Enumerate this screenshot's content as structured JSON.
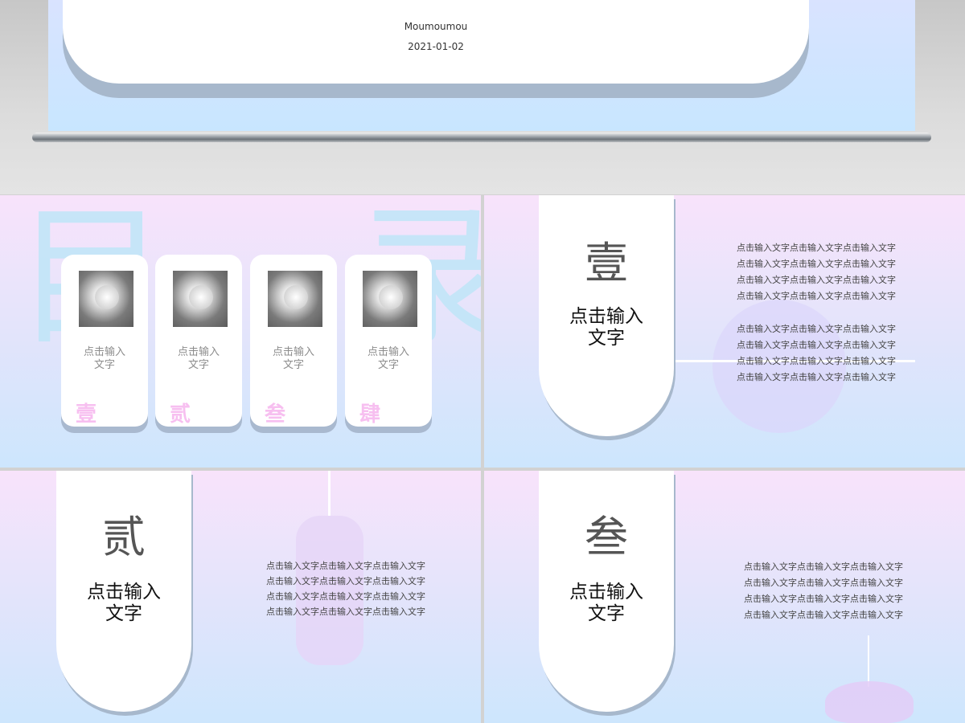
{
  "cover": {
    "author": "Moumoumou",
    "date": "2021-01-02"
  },
  "toc": {
    "background_chars": [
      "目",
      "录"
    ],
    "items": [
      {
        "label": "点击输入\n文字",
        "num": "壹"
      },
      {
        "label": "点击输入\n文字",
        "num": "贰"
      },
      {
        "label": "点击输入\n文字",
        "num": "叁"
      },
      {
        "label": "点击输入\n文字",
        "num": "肆"
      }
    ]
  },
  "section1": {
    "number": "壹",
    "title": "点击输入\n文字",
    "block1": [
      "点击输入文字点击输入文字点击输入文字",
      "点击输入文字点击输入文字点击输入文字",
      "点击输入文字点击输入文字点击输入文字",
      "点击输入文字点击输入文字点击输入文字"
    ],
    "block2": [
      "点击输入文字点击输入文字点击输入文字",
      "点击输入文字点击输入文字点击输入文字",
      "点击输入文字点击输入文字点击输入文字",
      "点击输入文字点击输入文字点击输入文字"
    ]
  },
  "section2": {
    "number": "贰",
    "title": "点击输入\n文字",
    "lines": [
      "点击输入文字点击输入文字点击输入文字",
      "点击输入文字点击输入文字点击输入文字",
      "点击输入文字点击输入文字点击输入文字",
      "点击输入文字点击输入文字点击输入文字"
    ]
  },
  "section3": {
    "number": "叁",
    "title": "点击输入\n文字",
    "lines": [
      "点击输入文字点击输入文字点击输入文字",
      "点击输入文字点击输入文字点击输入文字",
      "点击输入文字点击输入文字点击输入文字",
      "点击输入文字点击输入文字点击输入文字"
    ]
  },
  "colors": {
    "pink_number": "#f7bff0",
    "pill_shadow": "#a7b8cc",
    "bg_top": "#f8e3fb",
    "bg_bottom": "#cde6fd"
  }
}
